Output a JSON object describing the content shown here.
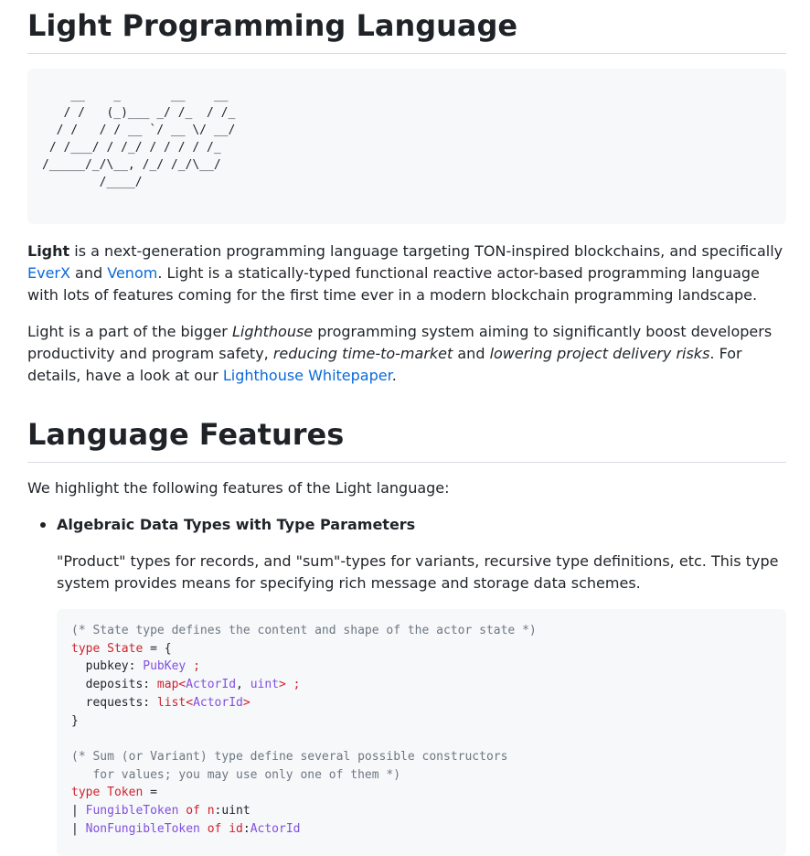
{
  "title": "Light Programming Language",
  "ascii_art": "    __    _       __    __\n   / /   (_)___ _/ /_  / /_\n  / /   / / __ `/ __ \\/ __/\n / /___/ / /_/ / / / / /_\n/_____/_/\\__, /_/ /_/\\__/\n        /____/",
  "intro": {
    "p1": {
      "bold": "Light",
      "t1": " is a next-generation programming language targeting TON-inspired blockchains, and specifically ",
      "link1": "EverX",
      "t2": " and ",
      "link2": "Venom",
      "t3": ". Light is a statically-typed functional reactive actor-based programming language with lots of features coming for the first time ever in a modern blockchain programming landscape."
    },
    "p2": {
      "t1": "Light is a part of the bigger ",
      "em1": "Lighthouse",
      "t2": " programming system aiming to significantly boost developers productivity and program safety, ",
      "em2": "reducing time-to-market",
      "t3": " and ",
      "em3": "lowering project delivery risks",
      "t4": ". For details, have a look at our ",
      "link": "Lighthouse Whitepaper",
      "t5": "."
    }
  },
  "features": {
    "heading": "Language Features",
    "intro": "We highlight the following features of the Light language:",
    "items": [
      {
        "title": "Algebraic Data Types with Type Parameters",
        "description": "\"Product\" types for records, and \"sum\"-types for variants, recursive type definitions, etc. This type system provides means for specifying rich message and storage data schemes."
      }
    ]
  },
  "code": {
    "comment1": "(* State type defines the content and shape of the actor state *)",
    "kw_type": "type",
    "state_name": "State",
    "eq_brace": " = {",
    "f1_name": "  pubkey: ",
    "f1_type": "PubKey",
    "semi": " ;",
    "f2_name": "  deposits: ",
    "f2_map": "map",
    "f2_lt": "<",
    "f2_actor": "ActorId",
    "f2_comma": ", ",
    "f2_uint": "uint",
    "f2_gt": ">",
    "f3_name": "  requests: ",
    "f3_list": "list",
    "f3_lt": "<",
    "f3_actor": "ActorId",
    "f3_gt": ">",
    "close_brace": "}",
    "comment2a": "(* Sum (or Variant) type define several possible constructors",
    "comment2b": "   for values; you may use only one of them *)",
    "token_name": "Token",
    "eq": " =",
    "pipe": "| ",
    "ctor1": "FungibleToken",
    "of": "of",
    "param1": "n",
    "colon": ":",
    "uint_plain": "uint",
    "ctor2": "NonFungibleToken",
    "param2": "id",
    "actorid": "ActorId"
  }
}
